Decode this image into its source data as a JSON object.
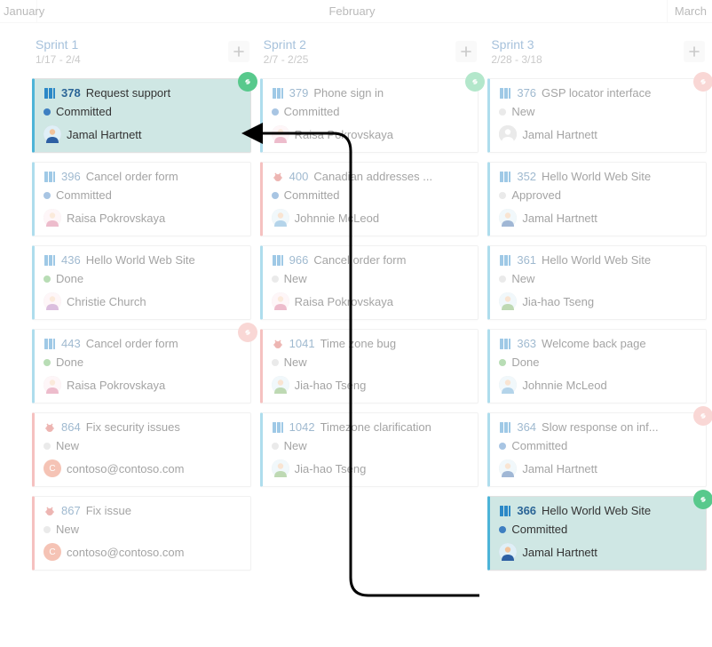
{
  "months": {
    "jan": "January",
    "feb": "February",
    "mar": "March"
  },
  "sprints": [
    {
      "name": "Sprint 1",
      "dates": "1/17 - 2/4",
      "cards": [
        {
          "type": "blue",
          "icon": "book",
          "num": "378",
          "title": "Request support",
          "status": "Committed",
          "statusKind": "committed",
          "user": "Jamal Hartnett",
          "avatar": "male1",
          "badge": "green",
          "highlighted": true
        },
        {
          "type": "blue",
          "icon": "book",
          "num": "396",
          "title": "Cancel order form",
          "status": "Committed",
          "statusKind": "committed",
          "user": "Raisa Pokrovskaya",
          "avatar": "female1"
        },
        {
          "type": "blue",
          "icon": "book",
          "num": "436",
          "title": "Hello World Web Site",
          "status": "Done",
          "statusKind": "done",
          "user": "Christie Church",
          "avatar": "female2"
        },
        {
          "type": "blue",
          "icon": "book",
          "num": "443",
          "title": "Cancel order form",
          "status": "Done",
          "statusKind": "done",
          "user": "Raisa Pokrovskaya",
          "avatar": "female1",
          "badge": "red"
        },
        {
          "type": "red",
          "icon": "bug",
          "num": "864",
          "title": "Fix security issues",
          "status": "New",
          "statusKind": "new",
          "user": "contoso@contoso.com",
          "avatar": "letterC"
        },
        {
          "type": "red",
          "icon": "bug",
          "num": "867",
          "title": "Fix issue",
          "status": "New",
          "statusKind": "new",
          "user": "contoso@contoso.com",
          "avatar": "letterC"
        }
      ]
    },
    {
      "name": "Sprint 2",
      "dates": "2/7 - 2/25",
      "cards": [
        {
          "type": "blue",
          "icon": "book",
          "num": "379",
          "title": "Phone sign in",
          "status": "Committed",
          "statusKind": "committed",
          "user": "Raisa Pokrovskaya",
          "avatar": "female1",
          "badge": "green"
        },
        {
          "type": "red",
          "icon": "bug",
          "num": "400",
          "title": "Canadian addresses ...",
          "status": "Committed",
          "statusKind": "committed",
          "user": "Johnnie McLeod",
          "avatar": "male2"
        },
        {
          "type": "blue",
          "icon": "book",
          "num": "966",
          "title": "Cancel order form",
          "status": "New",
          "statusKind": "new",
          "user": "Raisa Pokrovskaya",
          "avatar": "female1"
        },
        {
          "type": "red",
          "icon": "bug",
          "num": "1041",
          "title": "Time zone bug",
          "status": "New",
          "statusKind": "new",
          "user": "Jia-hao Tseng",
          "avatar": "male3"
        },
        {
          "type": "blue",
          "icon": "book",
          "num": "1042",
          "title": "Timezone clarification",
          "status": "New",
          "statusKind": "new",
          "user": "Jia-hao Tseng",
          "avatar": "male3"
        }
      ]
    },
    {
      "name": "Sprint 3",
      "dates": "2/28 - 3/18",
      "cards": [
        {
          "type": "blue",
          "icon": "book",
          "num": "376",
          "title": "GSP locator interface",
          "status": "New",
          "statusKind": "new",
          "user": "Jamal Hartnett",
          "avatar": "silhouette",
          "badge": "red"
        },
        {
          "type": "blue",
          "icon": "book",
          "num": "352",
          "title": "Hello World Web Site",
          "status": "Approved",
          "statusKind": "approved",
          "user": "Jamal Hartnett",
          "avatar": "male1"
        },
        {
          "type": "blue",
          "icon": "book",
          "num": "361",
          "title": "Hello World Web Site",
          "status": "New",
          "statusKind": "new",
          "user": "Jia-hao Tseng",
          "avatar": "male3"
        },
        {
          "type": "blue",
          "icon": "book",
          "num": "363",
          "title": "Welcome back page",
          "status": "Done",
          "statusKind": "done",
          "user": "Johnnie McLeod",
          "avatar": "male2"
        },
        {
          "type": "blue",
          "icon": "book",
          "num": "364",
          "title": "Slow response on inf...",
          "status": "Committed",
          "statusKind": "committed",
          "user": "Jamal Hartnett",
          "avatar": "male1",
          "badge": "red"
        },
        {
          "type": "blue",
          "icon": "book",
          "num": "366",
          "title": "Hello World Web Site",
          "status": "Committed",
          "statusKind": "committed",
          "user": "Jamal Hartnett",
          "avatar": "male1",
          "badge": "green",
          "highlighted": true
        }
      ]
    }
  ]
}
